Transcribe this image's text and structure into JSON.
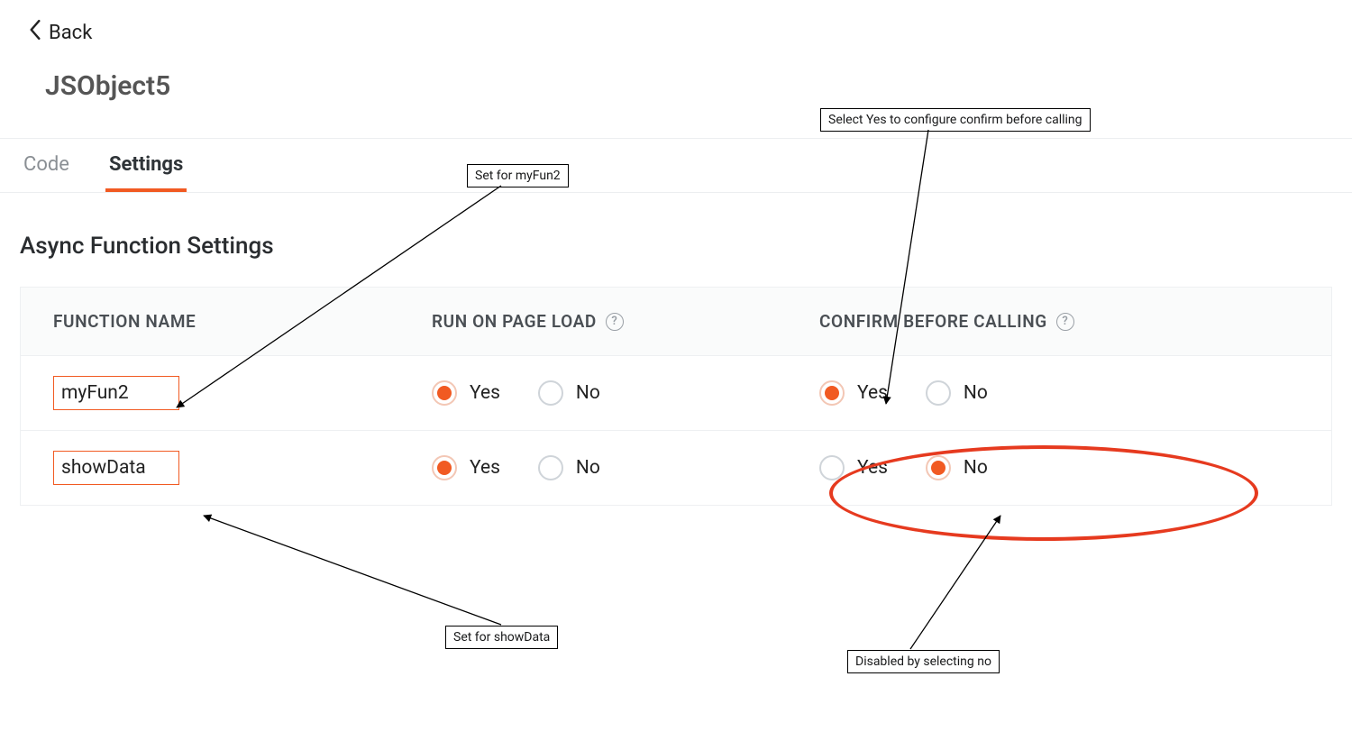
{
  "header": {
    "back_label": "Back",
    "title": "JSObject5"
  },
  "tabs": {
    "code": "Code",
    "settings": "Settings",
    "active": "settings"
  },
  "section": {
    "title": "Async Function Settings",
    "columns": {
      "name": "FUNCTION NAME",
      "run": "RUN ON PAGE LOAD",
      "confirm": "CONFIRM BEFORE CALLING"
    },
    "yes": "Yes",
    "no": "No",
    "rows": [
      {
        "name": "myFun2",
        "run": "yes",
        "confirm": "yes"
      },
      {
        "name": "showData",
        "run": "yes",
        "confirm": "no"
      }
    ]
  },
  "annotations": {
    "a1": "Set for myFun2",
    "a2": "Select Yes to configure confirm before calling",
    "a3": "Set for showData",
    "a4": "Disabled by selecting no"
  },
  "colors": {
    "accent": "#f15a22",
    "annotation_red": "#e63a1f"
  }
}
